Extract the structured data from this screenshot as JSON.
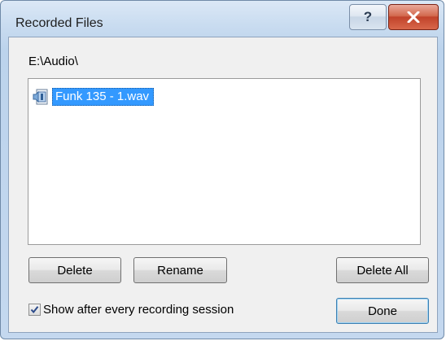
{
  "window": {
    "title": "Recorded Files",
    "help_glyph": "?",
    "close_icon": "close-icon"
  },
  "folder": {
    "path": "E:\\Audio\\"
  },
  "files": [
    {
      "name": "Funk 135 - 1.wav",
      "icon": "audio-file-icon",
      "selected": true
    }
  ],
  "buttons": {
    "delete": "Delete",
    "rename": "Rename",
    "delete_all": "Delete All",
    "done": "Done"
  },
  "options": {
    "show_after_label": "Show after every recording session",
    "show_after_checked": true
  },
  "colors": {
    "selection": "#3399ff",
    "close_button": "#c1432b"
  }
}
